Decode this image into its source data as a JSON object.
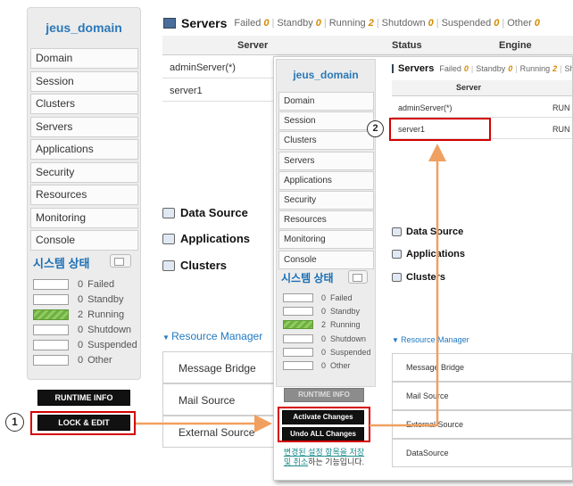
{
  "sidebar": {
    "title": "jeus_domain",
    "items": [
      "Domain",
      "Session",
      "Clusters",
      "Servers",
      "Applications",
      "Security",
      "Resources",
      "Monitoring",
      "Console"
    ],
    "system_status_title": "시스템 상태",
    "status_items": [
      {
        "count": "0",
        "label": "Failed"
      },
      {
        "count": "0",
        "label": "Standby"
      },
      {
        "count": "2",
        "label": "Running"
      },
      {
        "count": "0",
        "label": "Shutdown"
      },
      {
        "count": "0",
        "label": "Suspended"
      },
      {
        "count": "0",
        "label": "Other"
      }
    ],
    "runtime_info_label": "RUNTIME INFO",
    "lock_edit_label": "LOCK & EDIT",
    "activate_label": "Activate Changes",
    "undo_label": "Undo ALL Changes",
    "note": {
      "link": "변경된 설정 항목을 저장 및 취소",
      "text": "하는 기능입니다."
    }
  },
  "servers": {
    "title": "Servers",
    "counts": [
      {
        "label": "Failed",
        "value": "0"
      },
      {
        "label": "Standby",
        "value": "0"
      },
      {
        "label": "Running",
        "value": "2"
      },
      {
        "label": "Shutdown",
        "value": "0"
      },
      {
        "label": "Suspended",
        "value": "0"
      },
      {
        "label": "Other",
        "value": "0"
      }
    ],
    "columns": [
      "Server",
      "Status",
      "Engine"
    ],
    "rows": [
      {
        "server": "adminServer(*)",
        "status": "RUN"
      },
      {
        "server": "server1",
        "status": "RUN"
      }
    ]
  },
  "sections": [
    "Data Source",
    "Applications",
    "Clusters"
  ],
  "resource_manager": {
    "title": "Resource Manager",
    "items": [
      "Message Bridge",
      "Mail Source",
      "External Source",
      "DataSource"
    ]
  },
  "annotations": [
    "1",
    "2"
  ],
  "colors": {
    "callout": "#d40000",
    "arrow": "#f0a060",
    "accent": "#2a78b8"
  }
}
